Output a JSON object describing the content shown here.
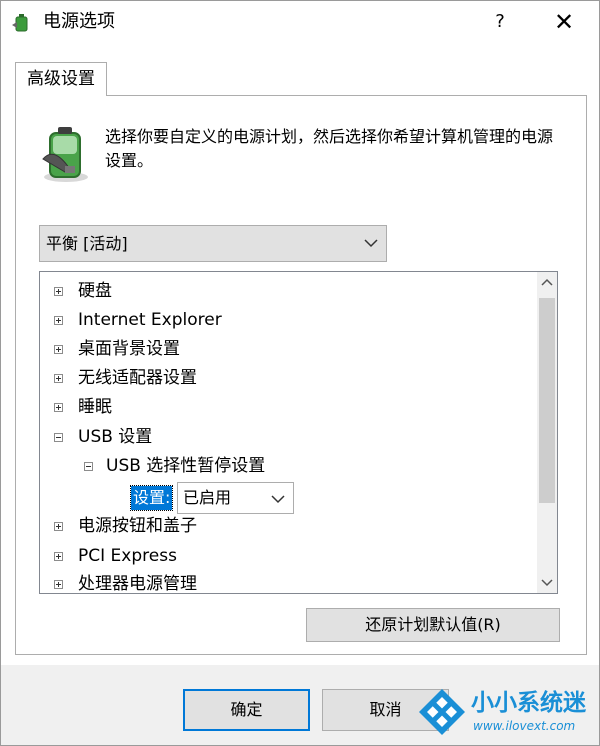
{
  "window": {
    "title": "电源选项",
    "help_label": "?",
    "close_label": "✕"
  },
  "tab": {
    "label": "高级设置"
  },
  "description": "选择你要自定义的电源计划，然后选择你希望计算机管理的电源设置。",
  "plan_select": {
    "value": "平衡 [活动]"
  },
  "tree": {
    "items": [
      {
        "label": "硬盘",
        "state": "collapsed"
      },
      {
        "label": "Internet Explorer",
        "state": "collapsed"
      },
      {
        "label": "桌面背景设置",
        "state": "collapsed"
      },
      {
        "label": "无线适配器设置",
        "state": "collapsed"
      },
      {
        "label": "睡眠",
        "state": "collapsed"
      },
      {
        "label": "USB 设置",
        "state": "expanded"
      },
      {
        "label": "USB 选择性暂停设置",
        "state": "expanded"
      },
      {
        "label": "电源按钮和盖子",
        "state": "collapsed"
      },
      {
        "label": "PCI Express",
        "state": "collapsed"
      },
      {
        "label": "处理器电源管理",
        "state": "collapsed"
      }
    ],
    "setting": {
      "label": "设置:",
      "value": "已启用"
    }
  },
  "buttons": {
    "restore": "还原计划默认值(R)",
    "ok": "确定",
    "cancel": "取消"
  },
  "watermark": {
    "title": "小小系统迷",
    "url": "www.ilovext.com"
  },
  "colors": {
    "accent": "#0078d7",
    "watermark": "#1a8fd6"
  }
}
